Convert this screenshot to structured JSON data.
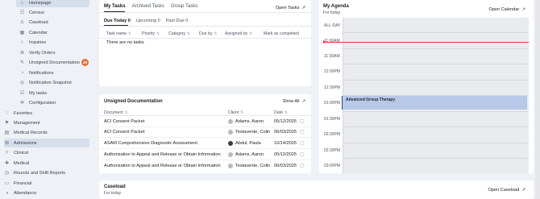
{
  "sidebar": {
    "items": [
      {
        "label": "Homepage",
        "icon": "home-icon",
        "sub": true,
        "active": true
      },
      {
        "label": "Census",
        "icon": "people-icon",
        "sub": true
      },
      {
        "label": "Caseload",
        "icon": "person-icon",
        "sub": true
      },
      {
        "label": "Calendar",
        "icon": "calendar-icon",
        "sub": true
      },
      {
        "label": "Inquiries",
        "icon": "inquiry-icon",
        "sub": true
      },
      {
        "label": "Verify Orders",
        "icon": "list-icon",
        "sub": true
      },
      {
        "label": "Unsigned Documentation",
        "icon": "pen-icon",
        "sub": true,
        "badge": "48"
      },
      {
        "label": "Notifications",
        "icon": "bell-icon",
        "sub": true
      },
      {
        "label": "Notification Snapshot",
        "icon": "snapshot-icon",
        "sub": true
      },
      {
        "label": "My tasks",
        "icon": "tasks-icon",
        "sub": true
      },
      {
        "label": "Configuration",
        "icon": "gear-icon",
        "sub": true
      },
      {
        "label": "Favorites",
        "icon": "heart-icon",
        "sub": false
      },
      {
        "label": "Management",
        "icon": "management-icon",
        "sub": false
      },
      {
        "label": "Medical Records",
        "icon": "records-icon",
        "sub": false
      },
      {
        "label": "Admissions",
        "icon": "admissions-icon",
        "sub": false,
        "active": true
      },
      {
        "label": "Clinical",
        "icon": "clinical-icon",
        "sub": false
      },
      {
        "label": "Medical",
        "icon": "medical-icon",
        "sub": false
      },
      {
        "label": "Rounds and Shift Reports",
        "icon": "rounds-icon",
        "sub": false
      },
      {
        "label": "Financial",
        "icon": "financial-icon",
        "sub": false
      },
      {
        "label": "Attendance",
        "icon": "attendance-icon",
        "sub": false
      }
    ]
  },
  "tasks": {
    "tabs": [
      "My Tasks",
      "Archived Tasks",
      "Group Tasks"
    ],
    "open_link": "Open Tasks",
    "subtabs": [
      "Due Today 0",
      "Upcoming 0",
      "Past Due 0"
    ],
    "columns": [
      "Task name",
      "Priority",
      "Category",
      "Due by",
      "Assigned by",
      "Mark as completed"
    ],
    "empty_text": "There are no tasks"
  },
  "unsigned": {
    "title": "Unsigned Documentation",
    "show_all": "Show All",
    "columns": [
      "Document",
      "Client",
      "Date"
    ],
    "rows": [
      {
        "document": "ACI Consent Packet",
        "client": "Adams, Aaron",
        "date": "05/12/2025",
        "avatar": "light"
      },
      {
        "document": "ACI Consent Packet",
        "client": "Testaverde, Colin",
        "date": "06/03/2025",
        "avatar": "light"
      },
      {
        "document": "ASAM Comprehensive Diagnostic Assessment",
        "client": "Abdul, Paula",
        "date": "10/14/2025",
        "avatar": "dark"
      },
      {
        "document": "Authorization to Appeal and Release or Obtain Information",
        "client": "Adams, Aaron",
        "date": "05/12/2025",
        "avatar": "light"
      },
      {
        "document": "Authorization to Appeal and Release or Obtain Information",
        "client": "Testaverde, Colin",
        "date": "06/03/2025",
        "avatar": "light"
      }
    ]
  },
  "agenda": {
    "title": "My Agenda",
    "subtitle": "For today",
    "open_link": "Open Calendar",
    "allday": "ALL-DAY",
    "times": [
      "11:00AM",
      "11:30AM",
      "12:00PM",
      "12:30PM",
      "01:00PM",
      "01:30PM",
      "02:00PM",
      "02:30PM",
      "03:00PM"
    ],
    "event": "Advanced Group Therapy"
  },
  "caseload": {
    "title": "Caseload",
    "subtitle": "For today",
    "open_link": "Open Caseload"
  },
  "colors": {
    "accent": "#d5deea",
    "badge": "#f06a35",
    "now_line": "#e53935",
    "event": "#b8c8e8"
  }
}
